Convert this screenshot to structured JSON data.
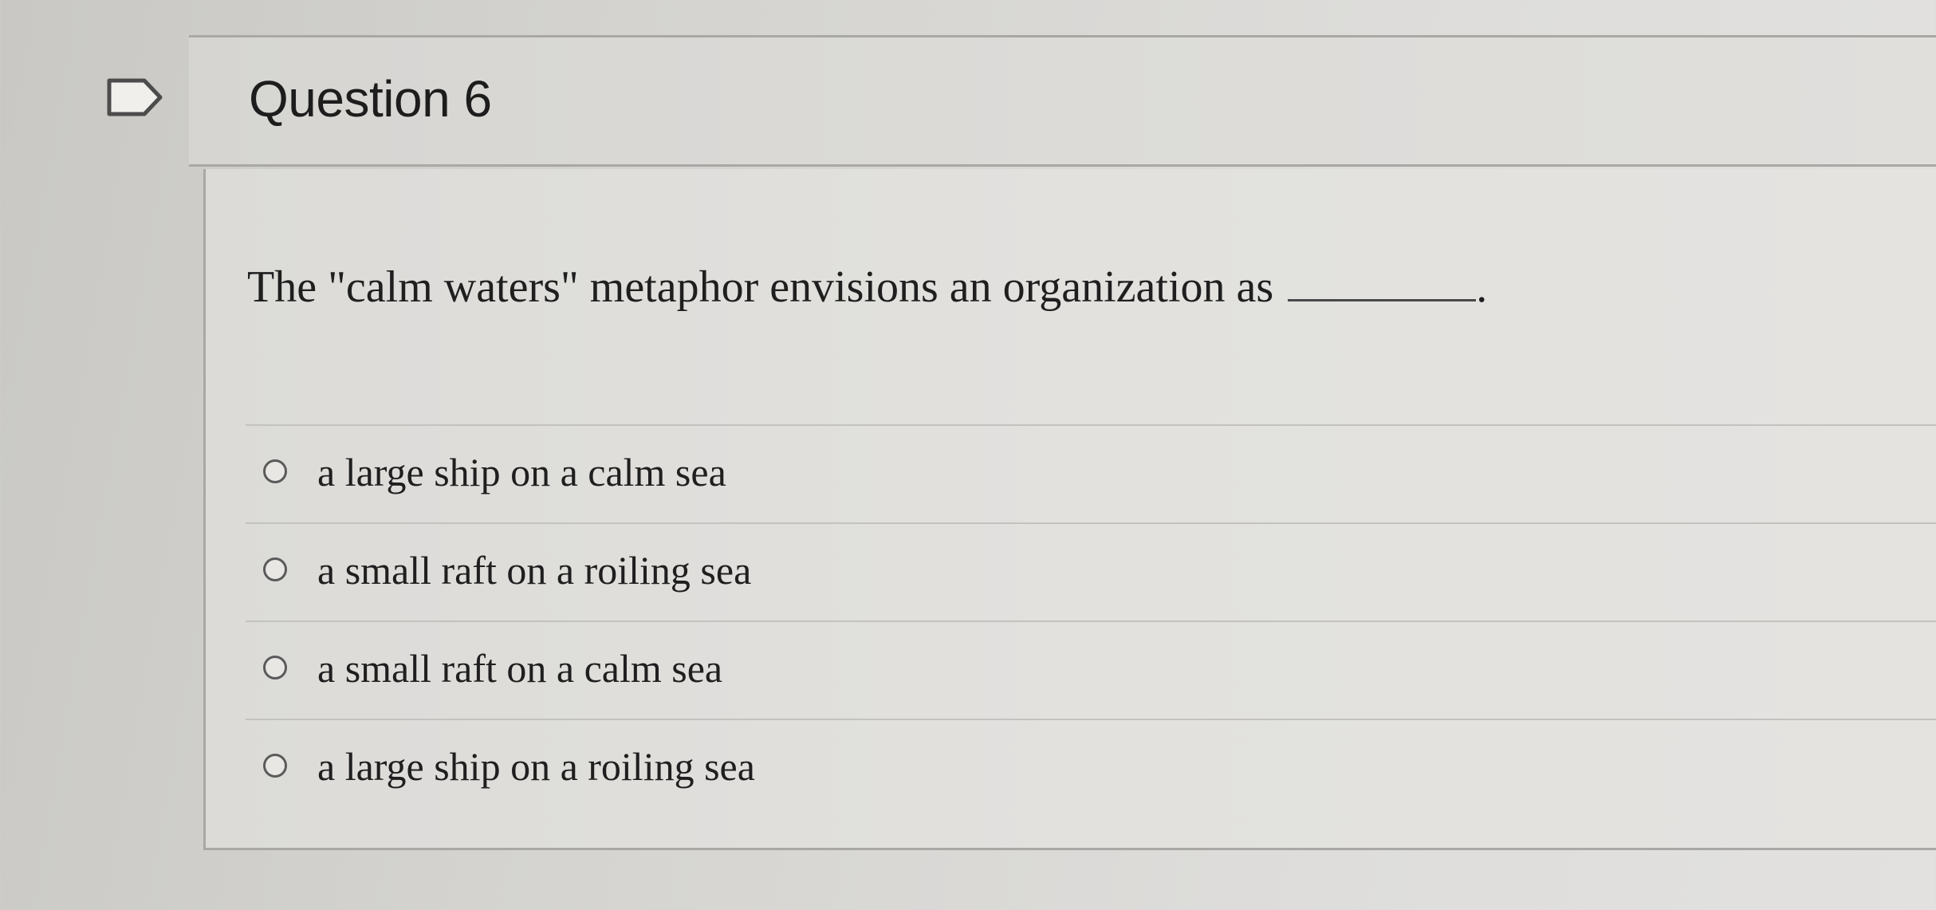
{
  "question": {
    "title": "Question 6",
    "text": "The \"calm waters\" metaphor envisions an organization as",
    "blank_suffix": "."
  },
  "answers": [
    {
      "label": "a large ship on a calm sea",
      "selected": false
    },
    {
      "label": "a small raft on a roiling sea",
      "selected": false
    },
    {
      "label": "a small raft on a calm sea",
      "selected": false
    },
    {
      "label": "a large ship on a roiling sea",
      "selected": false
    }
  ],
  "colors": {
    "background": "#d8d7d4",
    "header_background": "#dcdbd8",
    "border": "#a9a8a5",
    "text": "#1f1f1f",
    "radio_border": "#5a5a5a"
  },
  "icons": {
    "flag": "flag-question-icon",
    "radio": "radio-unchecked-icon"
  }
}
